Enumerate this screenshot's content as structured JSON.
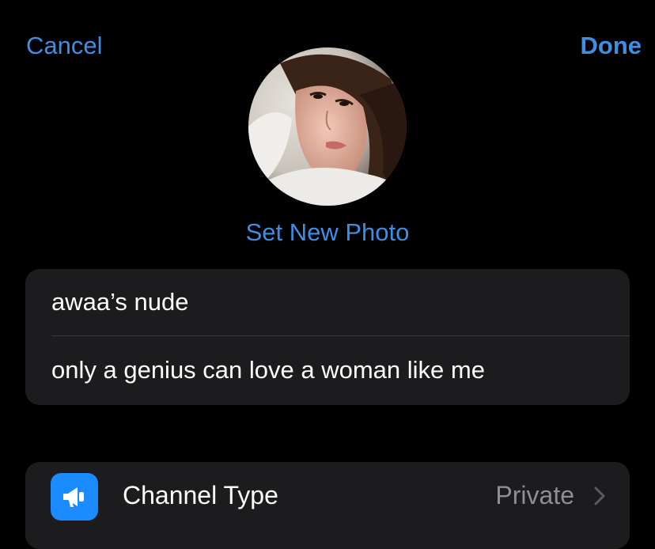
{
  "nav": {
    "cancel_label": "Cancel",
    "done_label": "Done"
  },
  "photo": {
    "set_new_label": "Set New Photo"
  },
  "info": {
    "name_value": "awaa’s nude",
    "description_value": "only a genius can love a woman like me"
  },
  "channel": {
    "type_label": "Channel Type",
    "type_value": "Private",
    "icon": "megaphone-icon"
  },
  "colors": {
    "accent": "#3d8fe6",
    "card": "#1c1c1e",
    "icon_bg": "#1a8cff",
    "secondary_text": "#8e8e93"
  }
}
